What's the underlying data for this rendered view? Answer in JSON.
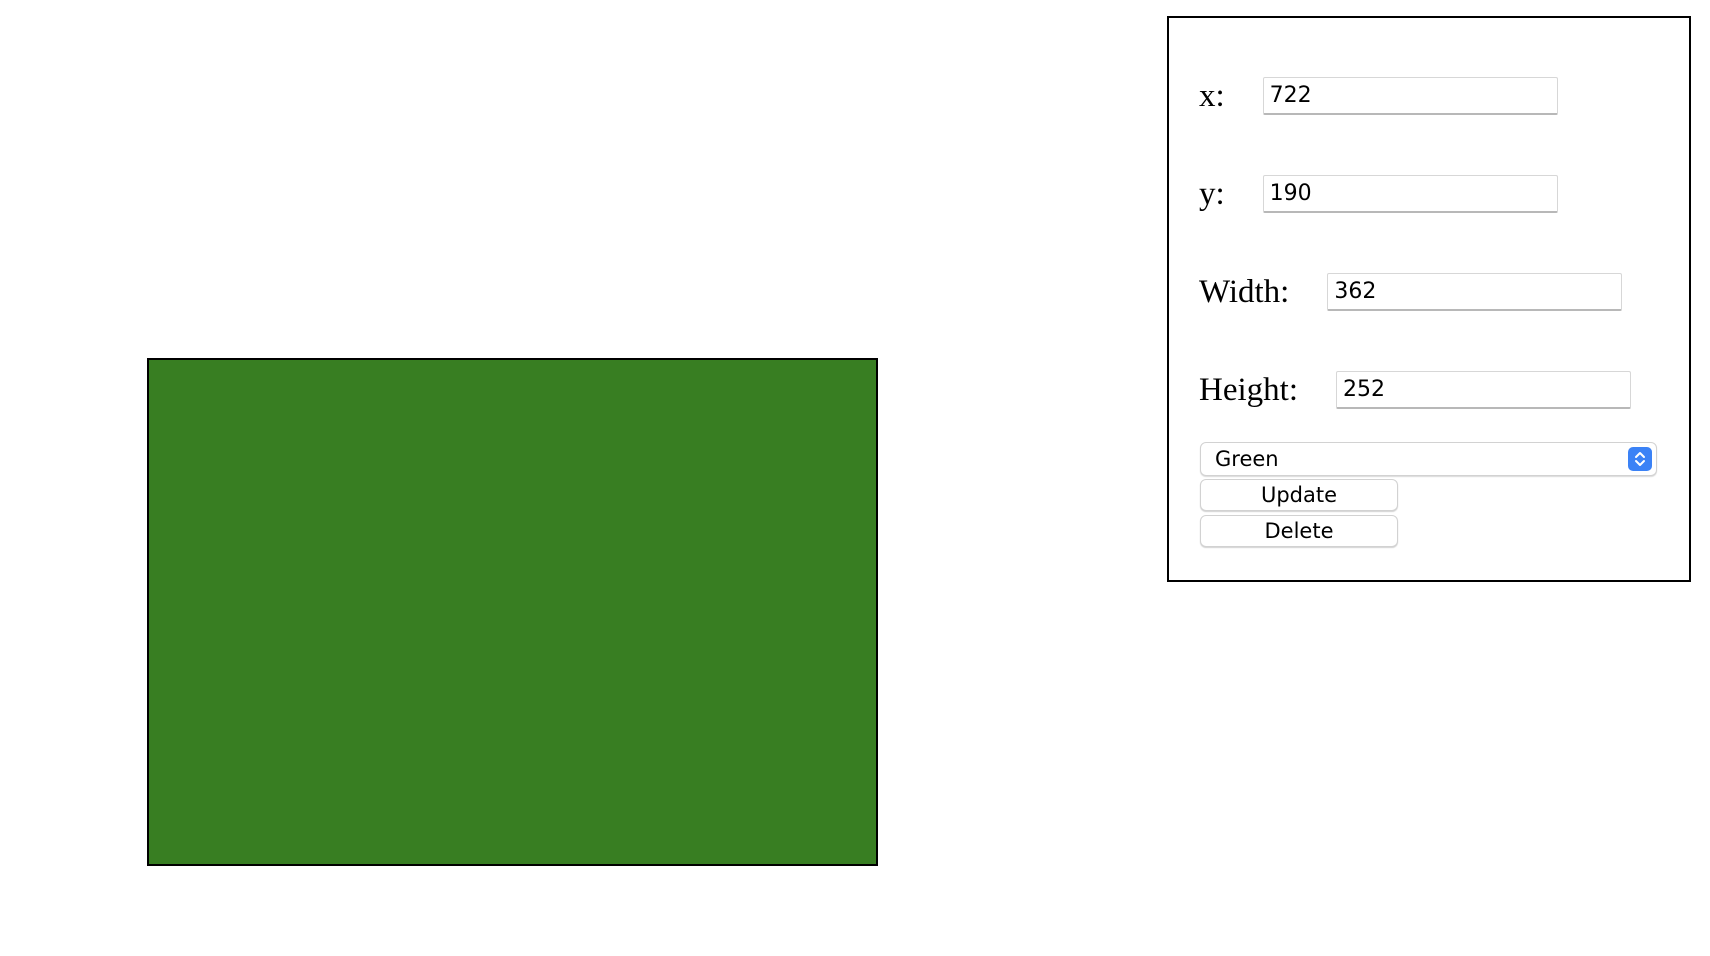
{
  "canvas": {
    "shape": {
      "fill_color": "#387e22",
      "border_color": "#000000"
    }
  },
  "panel": {
    "x": {
      "label": "x:",
      "value": "722"
    },
    "y": {
      "label": "y:",
      "value": "190"
    },
    "width": {
      "label": "Width:",
      "value": "362"
    },
    "height": {
      "label": "Height:",
      "value": "252"
    },
    "color_select": {
      "selected": "Green",
      "icon": "updown-chevron-icon",
      "accent_color": "#3b82f6"
    },
    "update_label": "Update",
    "delete_label": "Delete"
  }
}
